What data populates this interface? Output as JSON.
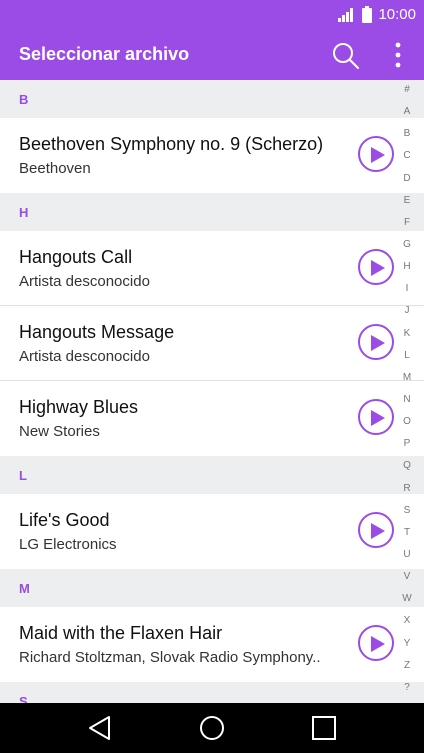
{
  "status": {
    "time": "10:00",
    "signal_icon": "signal-icon",
    "battery_icon": "battery-icon"
  },
  "header": {
    "title": "Seleccionar archivo",
    "search_icon": "search-icon",
    "more_icon": "more-vert-icon"
  },
  "sections": [
    {
      "letter": "B",
      "items": [
        {
          "title": "Beethoven Symphony no. 9 (Scherzo)",
          "artist": "Beethoven"
        }
      ]
    },
    {
      "letter": "H",
      "items": [
        {
          "title": "Hangouts Call",
          "artist": "Artista desconocido"
        },
        {
          "title": "Hangouts Message",
          "artist": "Artista desconocido"
        },
        {
          "title": "Highway Blues",
          "artist": "New Stories"
        }
      ]
    },
    {
      "letter": "L",
      "items": [
        {
          "title": "Life's Good",
          "artist": "LG Electronics"
        }
      ]
    },
    {
      "letter": "M",
      "items": [
        {
          "title": "Maid with the Flaxen Hair",
          "artist": "Richard Stoltzman, Slovak Radio Symphony.."
        }
      ]
    },
    {
      "letter": "S",
      "items": []
    }
  ],
  "alphabet": [
    "#",
    "A",
    "B",
    "C",
    "D",
    "E",
    "F",
    "G",
    "H",
    "I",
    "J",
    "K",
    "L",
    "M",
    "N",
    "O",
    "P",
    "Q",
    "R",
    "S",
    "T",
    "U",
    "V",
    "W",
    "X",
    "Y",
    "Z",
    "?"
  ],
  "nav": {
    "back_icon": "back-icon",
    "home_icon": "home-icon",
    "recents_icon": "recents-icon"
  },
  "colors": {
    "accent": "#9b4be6",
    "section_bg": "#eceef0",
    "nav_bg": "#000000"
  }
}
